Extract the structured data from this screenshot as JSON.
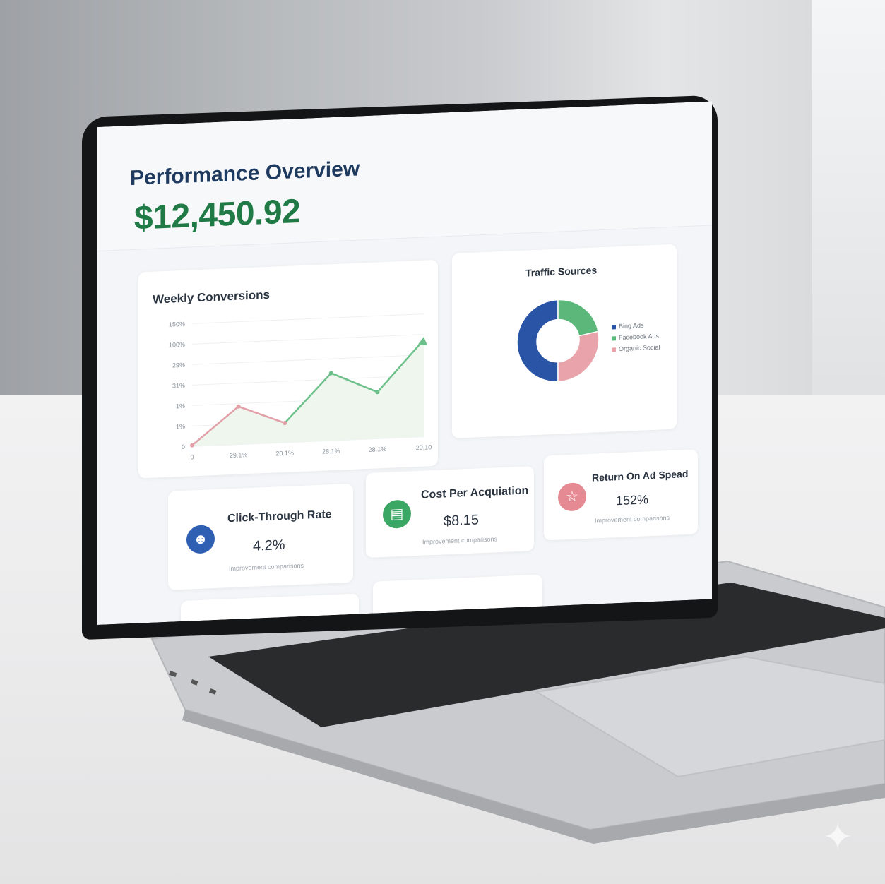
{
  "dashboard": {
    "title": "Performance Overview",
    "total": "$12,450.92"
  },
  "conversions_card": {
    "title": "Weekly Conversions"
  },
  "traffic_card": {
    "title": "Traffic Sources",
    "legend": [
      "Bing Ads",
      "Facebook Ads",
      "Organic Social"
    ]
  },
  "kpis": [
    {
      "title": "Click-Through Rate",
      "value": "4.2%",
      "sub": "Improvement comparisons",
      "icon": "user-icon",
      "color": "#2f5fb3"
    },
    {
      "title": "Cost Per Acquiation",
      "value": "$8.15",
      "sub": "Improvement comparisons",
      "icon": "document-icon",
      "color": "#3aa765"
    },
    {
      "title": "Return On Ad Spead",
      "value": "152%",
      "sub": "Improvement comparisons",
      "icon": "trophy-icon",
      "color": "#e58a93"
    }
  ],
  "colors": {
    "green": "#1f7a45",
    "navy": "#1f3a5f",
    "bing": "#2a55a6",
    "facebook": "#5cb87a",
    "organic": "#e9a3aa"
  },
  "chart_data": [
    {
      "type": "line",
      "title": "Weekly Conversions",
      "y_tick_labels": [
        "0",
        "1%",
        "1%",
        "31%",
        "29%",
        "100%",
        "150%"
      ],
      "x_tick_labels": [
        "0",
        "29.1%",
        "20.1%",
        "28.1%",
        "28.1%",
        "20.10"
      ],
      "series": [
        {
          "values": [
            1,
            31,
            16,
            55,
            38,
            79
          ]
        }
      ],
      "ylim": [
        0,
        100
      ],
      "grid": true
    },
    {
      "type": "pie",
      "title": "Traffic Sources",
      "categories": [
        "Bing Ads",
        "Facebook Ads",
        "Organic Social"
      ],
      "values": [
        50,
        22,
        28
      ],
      "donut": true
    }
  ]
}
